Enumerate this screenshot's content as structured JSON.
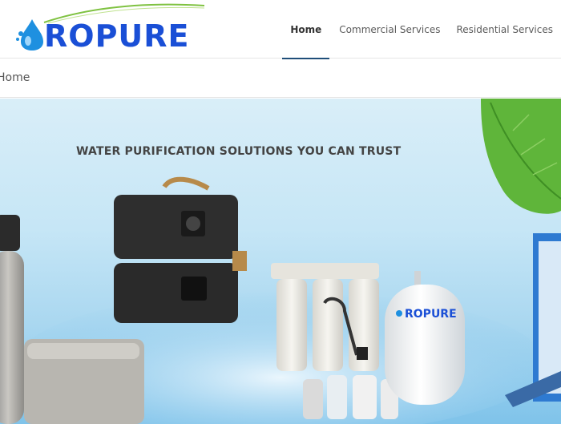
{
  "brand": {
    "name": "ROPURE",
    "accent": "#1a4fd6"
  },
  "nav": {
    "items": [
      {
        "label": "Home",
        "active": true
      },
      {
        "label": "Commercial Services",
        "active": false
      },
      {
        "label": "Residential Services",
        "active": false
      }
    ]
  },
  "breadcrumb": {
    "label": "Home"
  },
  "hero": {
    "title": "WATER PURIFICATION SOLUTIONS YOU CAN TRUST",
    "tank_label": "ROPURE"
  }
}
